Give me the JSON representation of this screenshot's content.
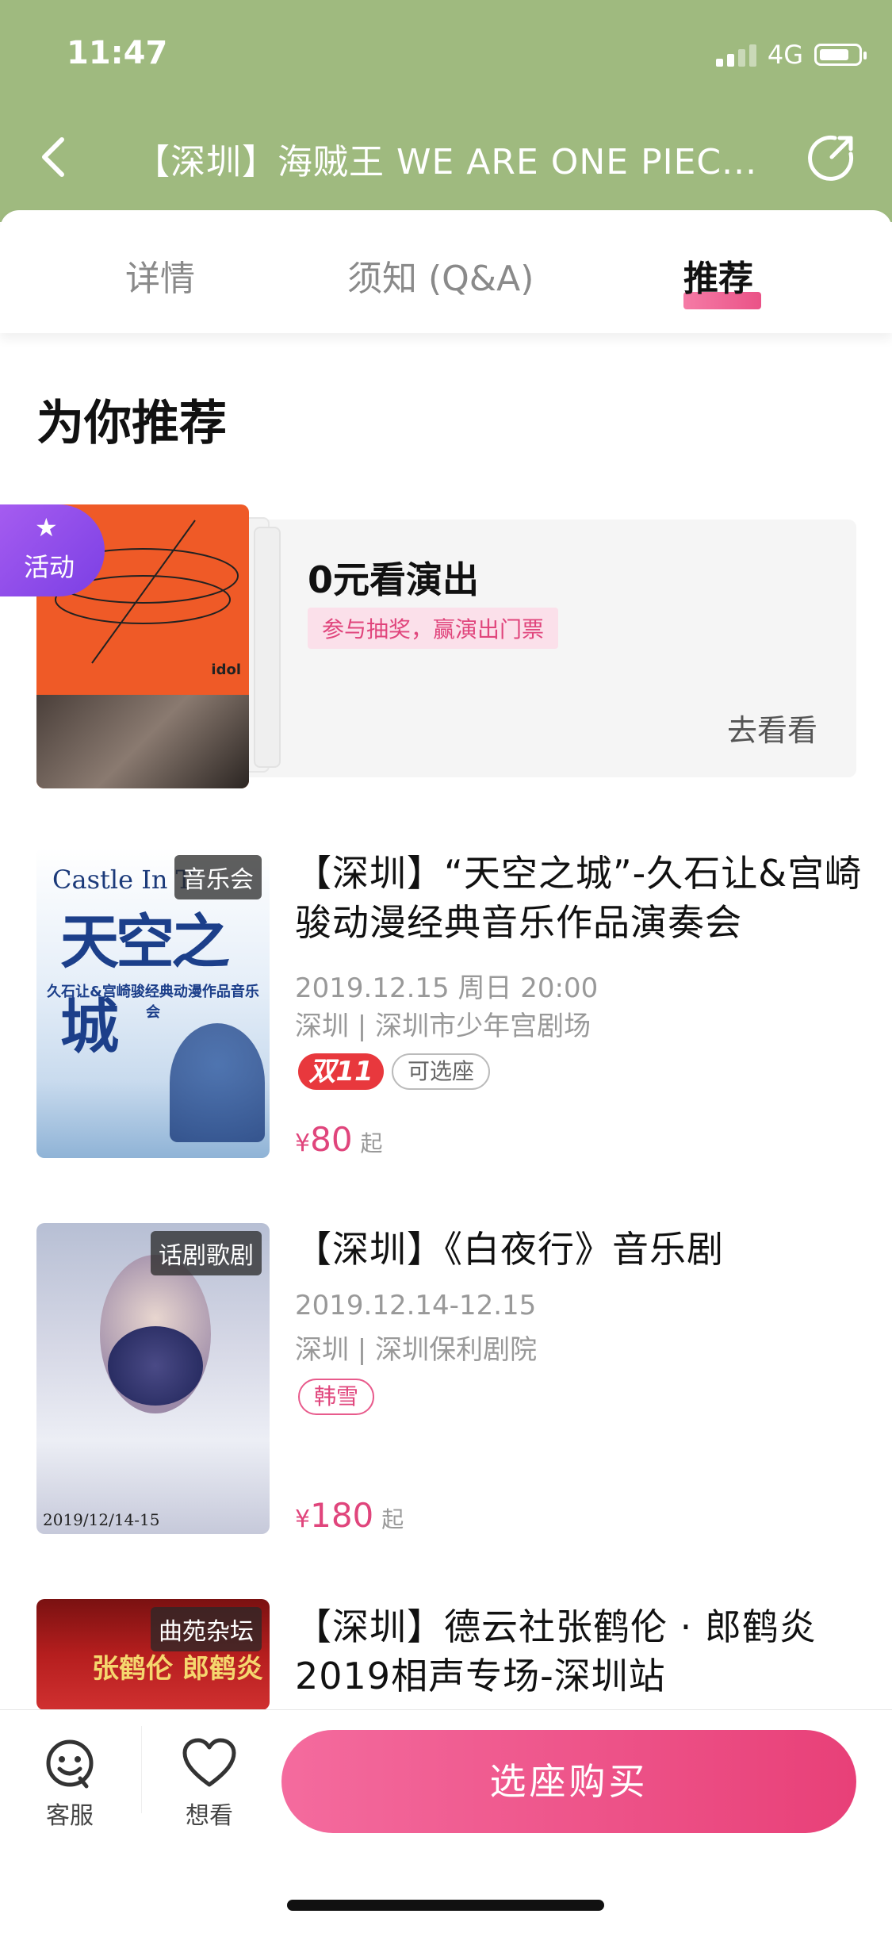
{
  "status": {
    "time": "11:47",
    "network": "4G"
  },
  "nav": {
    "title": "【深圳】海贼王 WE ARE ONE PIEC..."
  },
  "tabs": [
    {
      "label": "详情"
    },
    {
      "label": "须知 (Q&A)"
    },
    {
      "label": "推荐"
    }
  ],
  "section": {
    "title": "为你推荐"
  },
  "promo": {
    "badge": "活动",
    "title": "0元看演出",
    "tag": "参与抽奖，赢演出门票",
    "cta": "去看看",
    "poster_text": "idol"
  },
  "items": [
    {
      "category": "音乐会",
      "title": "【深圳】“天空之城”-久石让&宫崎骏动漫经典音乐作品演奏会",
      "date": "2019.12.15 周日 20:00",
      "venue": "深圳 | 深圳市少年宫剧场",
      "badge": "双11",
      "tag": "可选座",
      "price_symbol": "¥",
      "price": "80",
      "price_suffix": "起",
      "poster_en": "Castle In T",
      "poster_cn": "天空之城",
      "poster_sub": "久石让&宫崎骏经典动漫作品音乐会"
    },
    {
      "category": "话剧歌剧",
      "title": "【深圳】《白夜行》音乐剧",
      "date": "2019.12.14-12.15",
      "venue": "深圳 | 深圳保利剧院",
      "tag": "韩雪",
      "price_symbol": "¥",
      "price": "180",
      "price_suffix": "起",
      "poster_date": "2019/12/14-15"
    },
    {
      "category": "曲苑杂坛",
      "title": "【深圳】德云社张鹤伦 · 郎鹤炎2019相声专场-深圳站",
      "poster_text": "张鹤伦 郎鹤炎"
    }
  ],
  "bottom": {
    "service_label": "客服",
    "like_label": "想看",
    "buy_label": "选座购买"
  },
  "colors": {
    "header_green": "#9fba7f",
    "accent_pink": "#e84078",
    "badge_red": "#e8383d",
    "activity_purple": "#8a4ae8"
  }
}
